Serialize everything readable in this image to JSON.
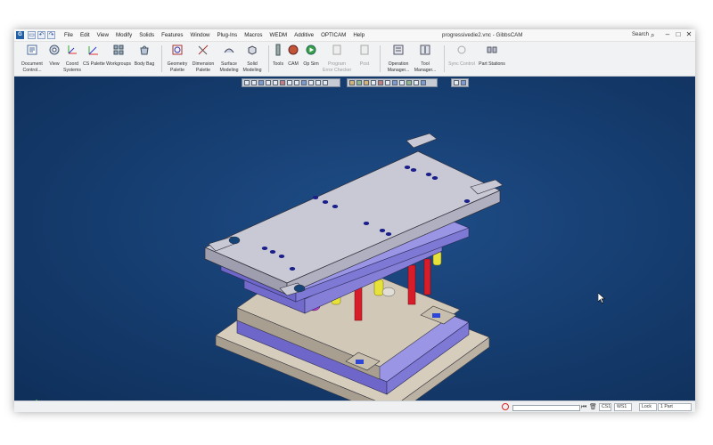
{
  "window": {
    "title": "progressivedie2.vnc - GibbsCAM",
    "app_icon_text": "G",
    "search_label": "Search",
    "controls": {
      "minimize": "–",
      "restore": "□",
      "close": "✕"
    }
  },
  "menu": [
    "File",
    "Edit",
    "View",
    "Modify",
    "Solids",
    "Features",
    "Window",
    "Plug-Ins",
    "Macros",
    "WEDM",
    "Additive",
    "OPTICAM",
    "Help"
  ],
  "ribbon": {
    "tools": [
      {
        "name": "document-control",
        "label1": "Document",
        "label2": "Control...",
        "disabled": false
      },
      {
        "name": "view",
        "label1": "View",
        "label2": "",
        "disabled": false
      },
      {
        "name": "coord-systems",
        "label1": "Coord",
        "label2": "Systems",
        "disabled": false
      },
      {
        "name": "cs-palette",
        "label1": "CS Palette",
        "label2": "",
        "disabled": false
      },
      {
        "name": "workgroups",
        "label1": "Workgroups",
        "label2": "",
        "disabled": false
      },
      {
        "name": "body-bag",
        "label1": "Body Bag",
        "label2": "",
        "disabled": false
      },
      {
        "name": "geometry-palette",
        "label1": "Geometry",
        "label2": "Palette",
        "disabled": false
      },
      {
        "name": "dimension-palette",
        "label1": "Dimension",
        "label2": "Palette",
        "disabled": false
      },
      {
        "name": "surface-modeling",
        "label1": "Surface",
        "label2": "Modeling",
        "disabled": false
      },
      {
        "name": "solid-modeling",
        "label1": "Solid",
        "label2": "Modeling",
        "disabled": false
      },
      {
        "name": "tools",
        "label1": "Tools",
        "label2": "",
        "disabled": false
      },
      {
        "name": "cam",
        "label1": "CAM",
        "label2": "",
        "disabled": false
      },
      {
        "name": "op-sim",
        "label1": "Op Sim",
        "label2": "",
        "disabled": false
      },
      {
        "name": "program-error-checker",
        "label1": "Program",
        "label2": "Error Checker",
        "disabled": true
      },
      {
        "name": "post",
        "label1": "Post",
        "label2": "",
        "disabled": true
      },
      {
        "name": "operation-manager",
        "label1": "Operation",
        "label2": "Manager...",
        "disabled": false
      },
      {
        "name": "tool-manager",
        "label1": "Tool",
        "label2": "Manager...",
        "disabled": false
      },
      {
        "name": "sync-control",
        "label1": "Sync Control",
        "label2": "",
        "disabled": true
      },
      {
        "name": "part-stations",
        "label1": "Part Stations",
        "label2": "",
        "disabled": false
      }
    ]
  },
  "status": {
    "cs_label": "CS1",
    "ws_label": "WS1",
    "lock_label": "Lock",
    "part_count": "1 Part"
  },
  "colors": {
    "viewport_bg": "#174476",
    "plate_top": "#c9c9d6",
    "plate_blue": "#8b86e0",
    "plate_tan": "#cbbfae",
    "pillar_red": "#d81d2a",
    "pillar_yellow": "#e7e23a",
    "bushing_magenta": "#c33bd1",
    "accent_blue": "#1f5fa8"
  }
}
